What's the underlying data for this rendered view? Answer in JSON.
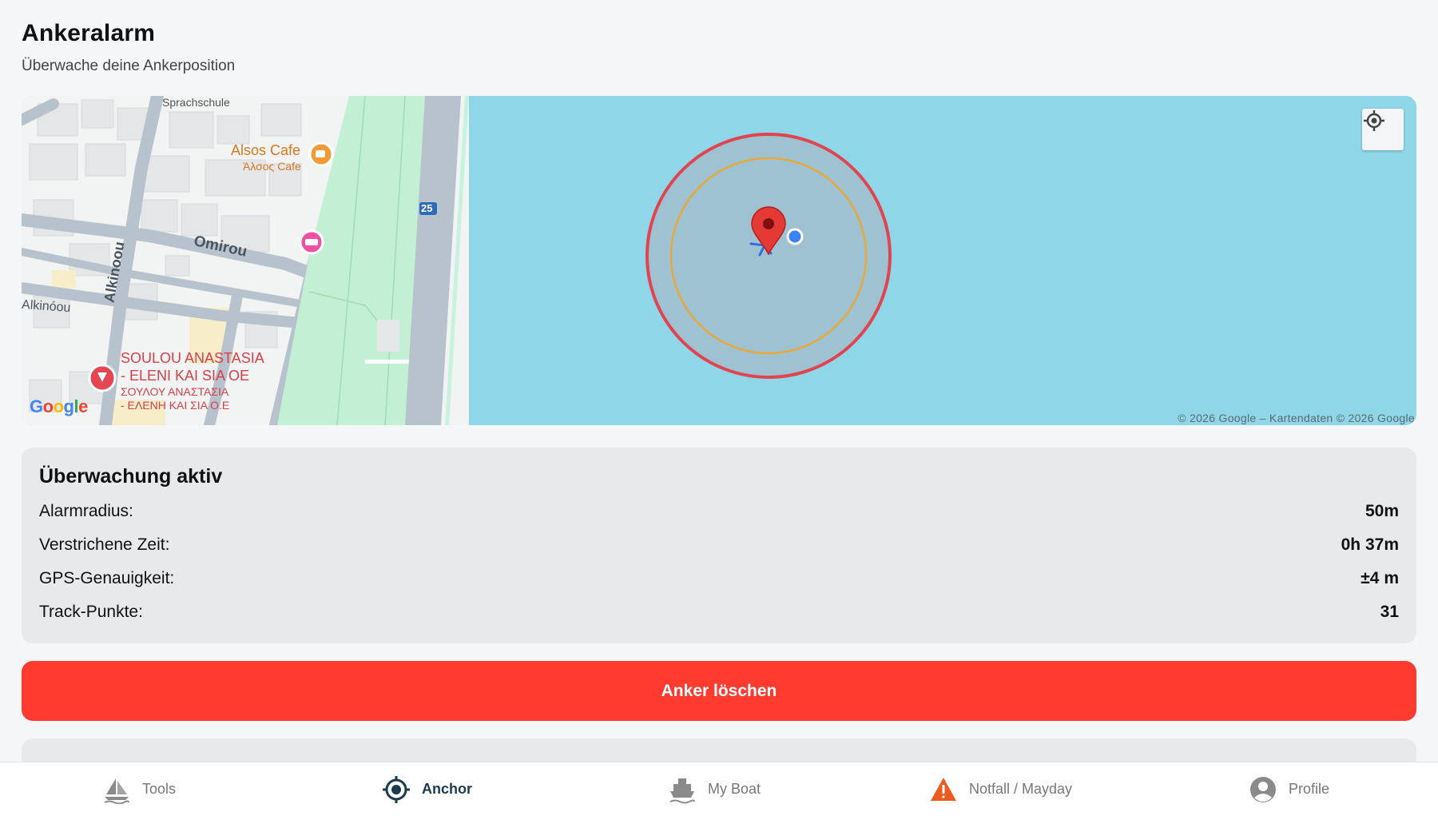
{
  "header": {
    "title": "Ankeralarm",
    "subtitle": "Überwache deine Ankerposition"
  },
  "map": {
    "labels": {
      "sprachschule": "Sprachschule",
      "cafe_name": "Alsos Cafe",
      "cafe_name_greek": "Άλσος Cafe",
      "street_omirou": "Omirou",
      "street_alkinoou": "Alkinoou",
      "street_alkinoou2": "Alkinóou",
      "route_number": "25",
      "business_line1": "SOULOU ANASTASIA",
      "business_line2": "- ELENI KAI SIA OE",
      "business_greek1": "ΣΟΥΛΟΥ ΑΝΑΣΤΑΣΙΑ",
      "business_greek2": "- ΕΛΕΝΗ ΚΑΙ ΣΙΑ Ο.Ε"
    },
    "attribution": "© 2026 Google – Kartendaten © 2026 Google",
    "google_logo": "Google",
    "colors": {
      "water": "#8fd7e8",
      "alarm_ring": "#e0454f",
      "warning_ring": "#e7a93c",
      "anchor_pin": "#e53935",
      "boat_dot": "#3b82f6"
    },
    "icons": {
      "locate": "crosshair-icon",
      "anchor_pin": "map-pin-icon",
      "boat_position": "gps-dot-icon"
    }
  },
  "status": {
    "title": "Überwachung aktiv",
    "rows": [
      {
        "label": "Alarmradius:",
        "value": "50m"
      },
      {
        "label": "Verstrichene Zeit:",
        "value": "0h 37m"
      },
      {
        "label": "GPS-Genauigkeit:",
        "value": "±4 m"
      },
      {
        "label": "Track-Punkte:",
        "value": "31"
      }
    ]
  },
  "actions": {
    "delete_anchor": "Anker löschen",
    "danger_color": "#ff3b30"
  },
  "tabs": [
    {
      "label": "Tools",
      "icon": "sailboat-icon"
    },
    {
      "label": "Anchor",
      "icon": "anchor-target-icon",
      "active": true
    },
    {
      "label": "My Boat",
      "icon": "ship-icon"
    },
    {
      "label": "Notfall / Mayday",
      "icon": "warning-triangle-icon"
    },
    {
      "label": "Profile",
      "icon": "user-circle-icon"
    }
  ]
}
